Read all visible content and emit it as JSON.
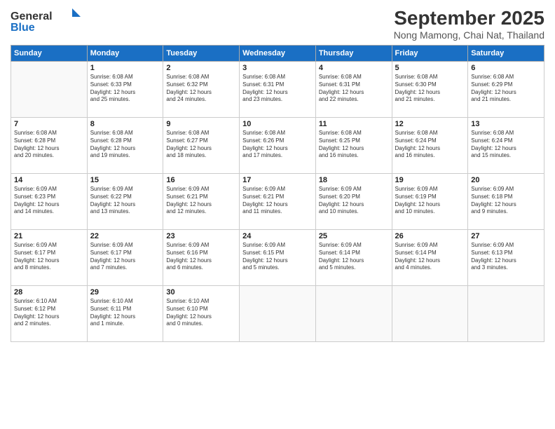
{
  "header": {
    "logo_general": "General",
    "logo_blue": "Blue",
    "month": "September 2025",
    "location": "Nong Mamong, Chai Nat, Thailand"
  },
  "weekdays": [
    "Sunday",
    "Monday",
    "Tuesday",
    "Wednesday",
    "Thursday",
    "Friday",
    "Saturday"
  ],
  "weeks": [
    [
      {
        "day": "",
        "info": ""
      },
      {
        "day": "1",
        "info": "Sunrise: 6:08 AM\nSunset: 6:33 PM\nDaylight: 12 hours\nand 25 minutes."
      },
      {
        "day": "2",
        "info": "Sunrise: 6:08 AM\nSunset: 6:32 PM\nDaylight: 12 hours\nand 24 minutes."
      },
      {
        "day": "3",
        "info": "Sunrise: 6:08 AM\nSunset: 6:31 PM\nDaylight: 12 hours\nand 23 minutes."
      },
      {
        "day": "4",
        "info": "Sunrise: 6:08 AM\nSunset: 6:31 PM\nDaylight: 12 hours\nand 22 minutes."
      },
      {
        "day": "5",
        "info": "Sunrise: 6:08 AM\nSunset: 6:30 PM\nDaylight: 12 hours\nand 21 minutes."
      },
      {
        "day": "6",
        "info": "Sunrise: 6:08 AM\nSunset: 6:29 PM\nDaylight: 12 hours\nand 21 minutes."
      }
    ],
    [
      {
        "day": "7",
        "info": "Sunrise: 6:08 AM\nSunset: 6:28 PM\nDaylight: 12 hours\nand 20 minutes."
      },
      {
        "day": "8",
        "info": "Sunrise: 6:08 AM\nSunset: 6:28 PM\nDaylight: 12 hours\nand 19 minutes."
      },
      {
        "day": "9",
        "info": "Sunrise: 6:08 AM\nSunset: 6:27 PM\nDaylight: 12 hours\nand 18 minutes."
      },
      {
        "day": "10",
        "info": "Sunrise: 6:08 AM\nSunset: 6:26 PM\nDaylight: 12 hours\nand 17 minutes."
      },
      {
        "day": "11",
        "info": "Sunrise: 6:08 AM\nSunset: 6:25 PM\nDaylight: 12 hours\nand 16 minutes."
      },
      {
        "day": "12",
        "info": "Sunrise: 6:08 AM\nSunset: 6:24 PM\nDaylight: 12 hours\nand 16 minutes."
      },
      {
        "day": "13",
        "info": "Sunrise: 6:08 AM\nSunset: 6:24 PM\nDaylight: 12 hours\nand 15 minutes."
      }
    ],
    [
      {
        "day": "14",
        "info": "Sunrise: 6:09 AM\nSunset: 6:23 PM\nDaylight: 12 hours\nand 14 minutes."
      },
      {
        "day": "15",
        "info": "Sunrise: 6:09 AM\nSunset: 6:22 PM\nDaylight: 12 hours\nand 13 minutes."
      },
      {
        "day": "16",
        "info": "Sunrise: 6:09 AM\nSunset: 6:21 PM\nDaylight: 12 hours\nand 12 minutes."
      },
      {
        "day": "17",
        "info": "Sunrise: 6:09 AM\nSunset: 6:21 PM\nDaylight: 12 hours\nand 11 minutes."
      },
      {
        "day": "18",
        "info": "Sunrise: 6:09 AM\nSunset: 6:20 PM\nDaylight: 12 hours\nand 10 minutes."
      },
      {
        "day": "19",
        "info": "Sunrise: 6:09 AM\nSunset: 6:19 PM\nDaylight: 12 hours\nand 10 minutes."
      },
      {
        "day": "20",
        "info": "Sunrise: 6:09 AM\nSunset: 6:18 PM\nDaylight: 12 hours\nand 9 minutes."
      }
    ],
    [
      {
        "day": "21",
        "info": "Sunrise: 6:09 AM\nSunset: 6:17 PM\nDaylight: 12 hours\nand 8 minutes."
      },
      {
        "day": "22",
        "info": "Sunrise: 6:09 AM\nSunset: 6:17 PM\nDaylight: 12 hours\nand 7 minutes."
      },
      {
        "day": "23",
        "info": "Sunrise: 6:09 AM\nSunset: 6:16 PM\nDaylight: 12 hours\nand 6 minutes."
      },
      {
        "day": "24",
        "info": "Sunrise: 6:09 AM\nSunset: 6:15 PM\nDaylight: 12 hours\nand 5 minutes."
      },
      {
        "day": "25",
        "info": "Sunrise: 6:09 AM\nSunset: 6:14 PM\nDaylight: 12 hours\nand 5 minutes."
      },
      {
        "day": "26",
        "info": "Sunrise: 6:09 AM\nSunset: 6:14 PM\nDaylight: 12 hours\nand 4 minutes."
      },
      {
        "day": "27",
        "info": "Sunrise: 6:09 AM\nSunset: 6:13 PM\nDaylight: 12 hours\nand 3 minutes."
      }
    ],
    [
      {
        "day": "28",
        "info": "Sunrise: 6:10 AM\nSunset: 6:12 PM\nDaylight: 12 hours\nand 2 minutes."
      },
      {
        "day": "29",
        "info": "Sunrise: 6:10 AM\nSunset: 6:11 PM\nDaylight: 12 hours\nand 1 minute."
      },
      {
        "day": "30",
        "info": "Sunrise: 6:10 AM\nSunset: 6:10 PM\nDaylight: 12 hours\nand 0 minutes."
      },
      {
        "day": "",
        "info": ""
      },
      {
        "day": "",
        "info": ""
      },
      {
        "day": "",
        "info": ""
      },
      {
        "day": "",
        "info": ""
      }
    ]
  ]
}
